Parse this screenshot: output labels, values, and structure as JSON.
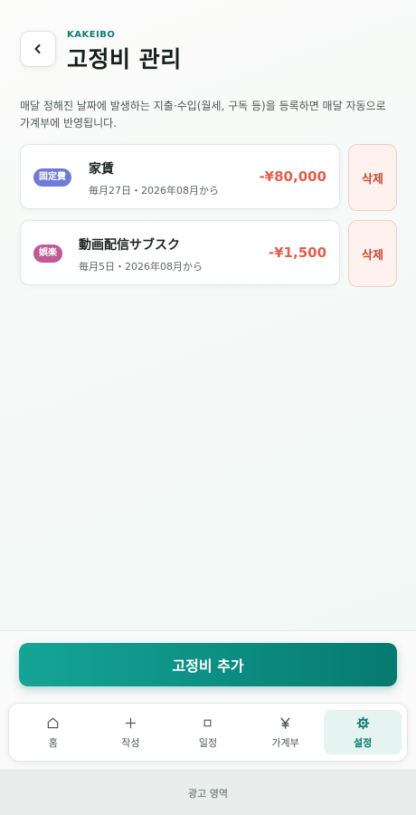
{
  "header": {
    "brand": "KAKEIBO",
    "title": "고정비 관리"
  },
  "description": "매달 정해진 날짜에 발생하는 지출·수입(월세, 구독 등)을 등록하면 매달 자동으로 가계부에 반영됩니다.",
  "items": [
    {
      "badge": "固定費",
      "badge_color": "#6f7bd6",
      "name": "家賃",
      "schedule": "毎月27日・2026年08月から",
      "amount": "-¥80,000",
      "delete_label": "삭제"
    },
    {
      "badge": "娯楽",
      "badge_color": "#c05a96",
      "name": "動画配信サブスク",
      "schedule": "毎月5日・2026年08月から",
      "amount": "-¥1,500",
      "delete_label": "삭제"
    }
  ],
  "add_button_label": "고정비 추가",
  "nav": [
    {
      "icon": "home-icon",
      "label": "홈",
      "active": false
    },
    {
      "icon": "plus-icon",
      "label": "작성",
      "active": false
    },
    {
      "icon": "square-icon",
      "label": "일정",
      "active": false
    },
    {
      "icon": "yen-icon",
      "label": "가계부",
      "active": false
    },
    {
      "icon": "gear-icon",
      "label": "설정",
      "active": true
    }
  ],
  "ad_label": "광고 영역",
  "colors": {
    "accent": "#0f7d73",
    "expense": "#e0604d",
    "delete": "#c74a38"
  }
}
